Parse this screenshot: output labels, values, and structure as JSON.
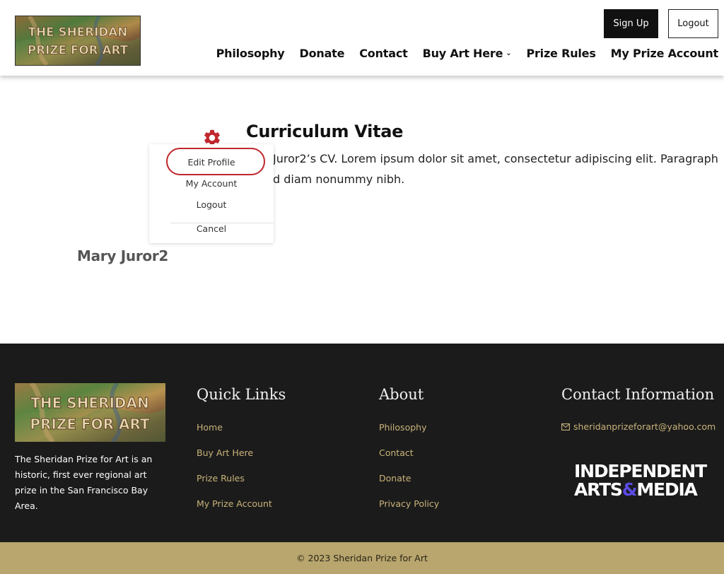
{
  "header": {
    "logo_text": "THE SHERIDAN PRIZE FOR ART",
    "signup_label": "Sign Up",
    "logout_label": "Logout",
    "nav": {
      "philosophy": "Philosophy",
      "donate": "Donate",
      "contact": "Contact",
      "buy_art": "Buy Art Here",
      "prize_rules": "Prize Rules",
      "my_prize_account": "My Prize Account"
    }
  },
  "main": {
    "title": "Curriculum Vitae",
    "cv_line1": "Juror2’s CV. Lorem ipsum dolor sit amet, consectetur adipiscing elit. Paragraph",
    "cv_line2": "d diam nonummy nibh.",
    "name": "Mary Juror2"
  },
  "dropdown": {
    "edit_profile": "Edit Profile",
    "my_account": "My Account",
    "logout": "Logout",
    "cancel": "Cancel"
  },
  "footer": {
    "description": "The Sheridan Prize for Art is an historic, first ever regional art prize in the San Francisco Bay Area.",
    "quick_links": {
      "heading": "Quick Links",
      "items": [
        "Home",
        "Buy Art Here",
        "Prize Rules",
        "My Prize Account"
      ]
    },
    "about": {
      "heading": "About",
      "items": [
        "Philosophy",
        "Contact",
        "Donate",
        "Privacy Policy"
      ]
    },
    "contact": {
      "heading": "Contact Information",
      "email": "sheridanprizeforart@yahoo.com"
    },
    "partner_logo": {
      "line1": "INDEPENDENT",
      "line2_a": "ARTS",
      "line2_amp": "&",
      "line2_b": "MEDIA"
    },
    "copyright": "© 2023 Sheridan Prize for Art"
  },
  "colors": {
    "accent_gold": "#c9b37a",
    "footer_bg": "#1b1b1b",
    "bottom_bar": "#b8a66e",
    "gear_red": "#c0272d",
    "highlight_red": "#c0272d"
  }
}
